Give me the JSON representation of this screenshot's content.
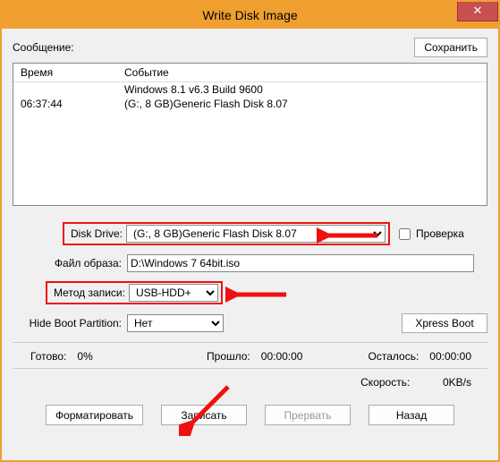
{
  "window": {
    "title": "Write Disk Image"
  },
  "msg": {
    "label": "Сообщение:",
    "save_btn": "Сохранить"
  },
  "log": {
    "col_time": "Время",
    "col_event": "Событие",
    "rows": [
      {
        "time": "",
        "event": "Windows 8.1 v6.3 Build 9600"
      },
      {
        "time": "06:37:44",
        "event": "(G:, 8 GB)Generic Flash Disk     8.07"
      }
    ]
  },
  "disk_drive": {
    "label": "Disk Drive:",
    "value": "(G:, 8 GB)Generic Flash Disk     8.07",
    "check_label": "Проверка"
  },
  "image_file": {
    "label": "Файл образа:",
    "value": "D:\\Windows 7 64bit.iso"
  },
  "write_method": {
    "label": "Метод записи:",
    "value": "USB-HDD+"
  },
  "hide_boot": {
    "label": "Hide Boot Partition:",
    "value": "Нет",
    "xpress_btn": "Xpress Boot"
  },
  "status": {
    "ready_label": "Готово:",
    "ready_val": "0%",
    "elapsed_label": "Прошло:",
    "elapsed_val": "00:00:00",
    "remain_label": "Осталось:",
    "remain_val": "00:00:00",
    "speed_label": "Скорость:",
    "speed_val": "0KB/s"
  },
  "buttons": {
    "format": "Форматировать",
    "write": "Записать",
    "abort": "Прервать",
    "back": "Назад"
  }
}
